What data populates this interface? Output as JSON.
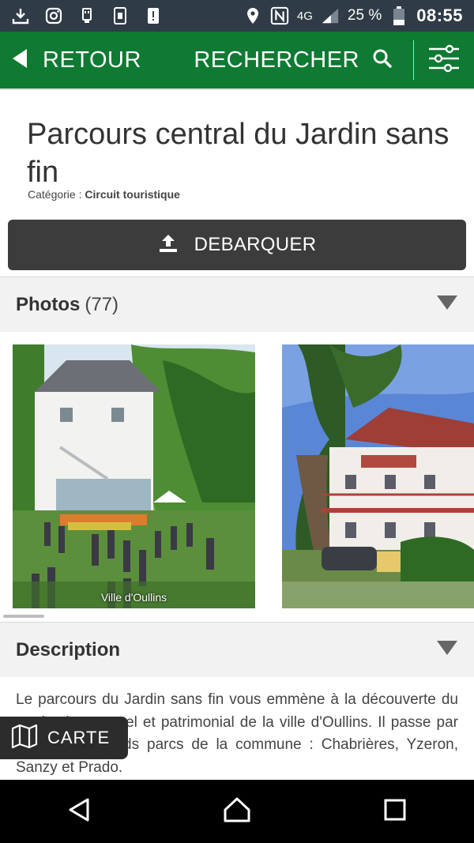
{
  "status": {
    "network": "4G",
    "battery": "25 %",
    "time": "08:55"
  },
  "header": {
    "back_label": "RETOUR",
    "search_label": "RECHERCHER"
  },
  "poi": {
    "title": "Parcours central du Jardin sans fin",
    "category_label": "Catégorie :",
    "category_value": "Circuit touristique"
  },
  "actions": {
    "debark_label": "DEBARQUER",
    "map_label": "CARTE"
  },
  "photos_section": {
    "title": "Photos",
    "count": "(77)",
    "items": [
      {
        "caption": "Ville d'Oullins"
      },
      {
        "caption": ""
      }
    ]
  },
  "description_section": {
    "title": "Description",
    "text": "Le parcours du Jardin sans fin vous emmène à la découverte du patrimoine naturel et patrimonial de la ville d'Oullins. Il passe par les quatre grands parcs de la commune : Chabrières, Yzeron, Sanzy et Prado."
  },
  "colors": {
    "header_green": "#0f7a32",
    "status_bar": "#2f3b46",
    "button_dark": "#3c3c3c"
  }
}
